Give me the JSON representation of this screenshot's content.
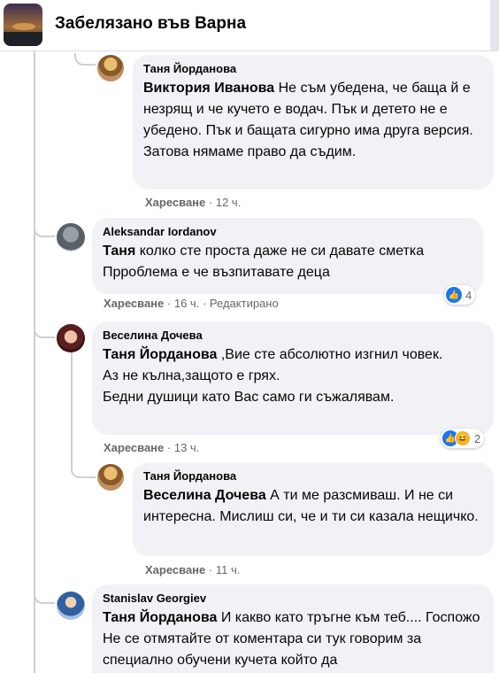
{
  "header": {
    "group_title": "Забелязано във Варна"
  },
  "comments": [
    {
      "author": "Таня Йорданова",
      "mention": "Виктория Иванова",
      "text": " Не съм убедена, че баща й е незрящ и че кучето е водач. Пък и детето не е убедено. Пък и бащата сигурно има друга версия. Затова нямаме право да съдим.",
      "like_label": "Харесване",
      "time": "12 ч."
    },
    {
      "author": "Aleksandar Iordanov",
      "mention": "Таня",
      "text": " колко сте проста даже не си давате сметка Прроблема е че възпитавате деца",
      "like_label": "Харесване",
      "time": "16 ч.",
      "edited": "Редактирано",
      "reaction_count": "4"
    },
    {
      "author": "Веселина Дочева",
      "mention": "Таня Йорданова",
      "text": " ,Вие сте абсолютно изгнил човек.\nАз не кълна,защото е грях.\nБедни душици като Вас само ги съжалявам.",
      "like_label": "Харесване",
      "time": "13 ч.",
      "reaction_count": "2"
    },
    {
      "author": "Таня Йорданова",
      "mention": "Веселина Дочева",
      "text": " А ти ме разсмиваш. И не си интересна. Мислиш си, че и ти си казала нещичко.",
      "like_label": "Харесване",
      "time": "11 ч."
    },
    {
      "author": "Stanislav Georgiev",
      "mention": "Таня Йорданова",
      "text": " И какво като тръгне към теб.... Госпожо Не се отмятайте от коментара си тук говорим за специално обучени кучета който да"
    }
  ],
  "separator": "·"
}
